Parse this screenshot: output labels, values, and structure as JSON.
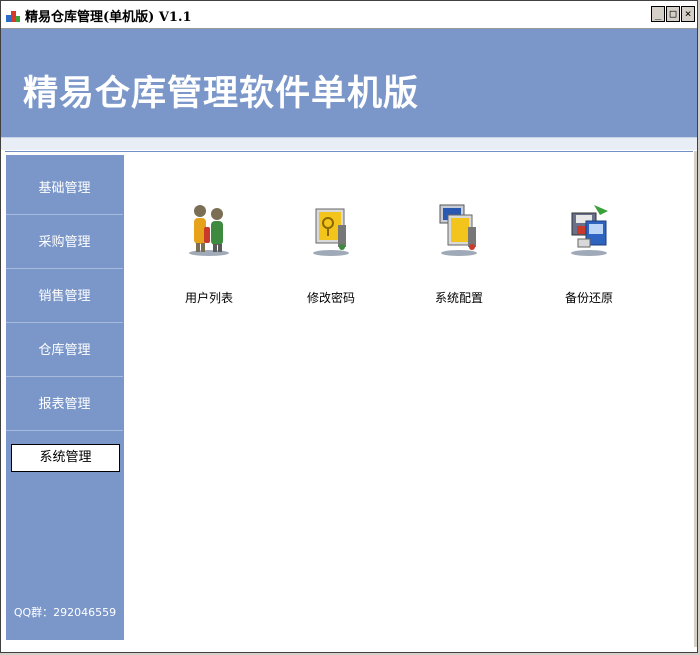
{
  "window": {
    "title": "精易仓库管理(单机版) V1.1",
    "minimize_glyph": "_",
    "maximize_glyph": "□",
    "close_glyph": "×"
  },
  "banner": {
    "title": "精易仓库管理软件单机版"
  },
  "sidebar": {
    "items": [
      {
        "label": "基础管理",
        "active": false
      },
      {
        "label": "采购管理",
        "active": false
      },
      {
        "label": "销售管理",
        "active": false
      },
      {
        "label": "仓库管理",
        "active": false
      },
      {
        "label": "报表管理",
        "active": false
      },
      {
        "label": "系统管理",
        "active": true
      }
    ],
    "footer": "QQ群：292046559"
  },
  "tiles": [
    {
      "label": "用户列表",
      "icon": "users-icon"
    },
    {
      "label": "修改密码",
      "icon": "change-password-icon"
    },
    {
      "label": "系统配置",
      "icon": "system-config-icon"
    },
    {
      "label": "备份还原",
      "icon": "backup-restore-icon"
    }
  ],
  "colors": {
    "banner": "#7b97c9",
    "sidebar": "#7b97c9",
    "active_item_bg": "#ffffff"
  }
}
